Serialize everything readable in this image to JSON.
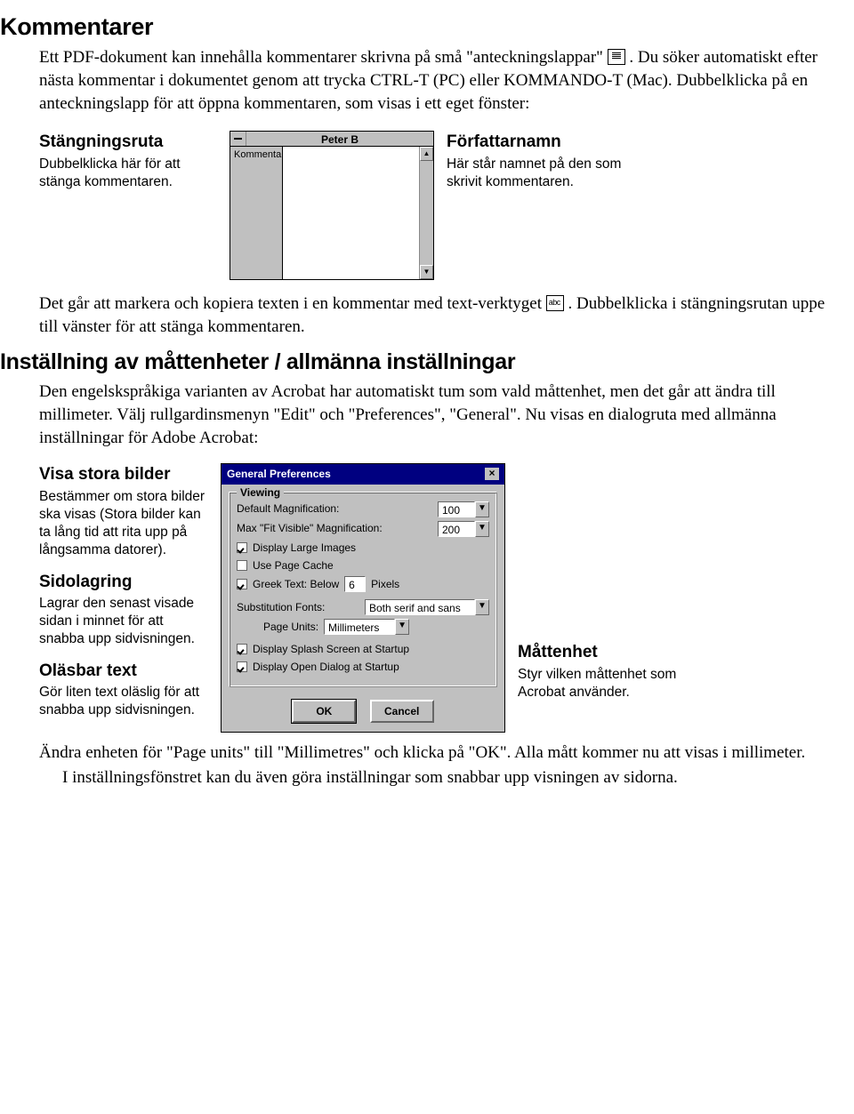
{
  "headings": {
    "kommentarer": "Kommentarer",
    "installning": "Inställning av måttenheter / allmänna inställningar"
  },
  "paras": {
    "p1a": "Ett PDF-dokument kan innehålla kommentarer skrivna på små \"anteckningslappar\" ",
    "p1b": ". Du söker automatiskt efter nästa kommentar i dokumentet genom att trycka CTRL-T (PC) eller KOMMANDO-T (Mac). Dubbelklicka på en anteckningslapp för att öppna kommentaren, som visas i ett eget fönster:",
    "p2a": "Det går att markera och kopiera texten i en kommentar med text-verktyget ",
    "p2b": ". Dubbelklicka i stängningsrutan uppe till vänster för att stänga kommentaren.",
    "p3": "Den engelskspråkiga varianten av Acrobat har automatiskt tum som vald måttenhet, men det går att ändra till millimeter. Välj rullgardinsmenyn \"Edit\" och \"Preferences\", \"General\". Nu visas en dialogruta med allmänna inställningar för Adobe Acrobat:",
    "p4": "Ändra enheten för \"Page units\" till \"Millimetres\" och klicka på \"OK\". Alla mått kommer nu att visas i millimeter.",
    "p5": "I inställningsfönstret kan du även göra inställningar som snabbar upp visningen av sidorna."
  },
  "callouts": {
    "stang_title": "Stängningsruta",
    "stang_text": "Dubbelklicka här för att stänga kommentaren.",
    "forf_title": "Författarnamn",
    "forf_text": "Här står namnet på den som skrivit kommentaren.",
    "visa_title": "Visa stora bilder",
    "visa_text": "Bestämmer om stora bilder ska visas (Stora bilder kan ta lång tid att rita upp på långsamma datorer).",
    "sido_title": "Sidolagring",
    "sido_text": "Lagrar den senast visade sidan i minnet för att snabba upp sidvisningen.",
    "olas_title": "Oläsbar text",
    "olas_text": "Gör liten text oläslig för att snabba upp sidvisningen.",
    "matt_title": "Måttenhet",
    "matt_text": "Styr vilken måttenhet som Acrobat använder."
  },
  "comment_window": {
    "titlebar": "Peter B",
    "label": "Kommentar"
  },
  "prefs": {
    "title": "General Preferences",
    "group": "Viewing",
    "default_mag_label": "Default Magnification:",
    "default_mag_value": "100",
    "max_fit_label": "Max \"Fit Visible\" Magnification:",
    "max_fit_value": "200",
    "display_large": "Display Large Images",
    "use_cache": "Use Page Cache",
    "greek_label": "Greek Text: Below",
    "greek_value": "6",
    "greek_suffix": "Pixels",
    "sub_fonts_label": "Substitution Fonts:",
    "sub_fonts_value": "Both serif and sans",
    "page_units_label": "Page Units:",
    "page_units_value": "Millimeters",
    "splash": "Display Splash Screen at Startup",
    "open_dialog": "Display Open Dialog at Startup",
    "ok": "OK",
    "cancel": "Cancel"
  },
  "icons": {
    "note_icon": "note-icon",
    "text_tool_icon": "abc"
  }
}
